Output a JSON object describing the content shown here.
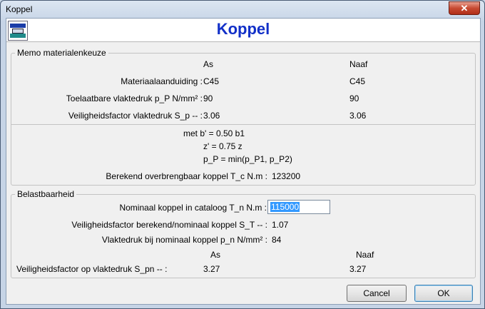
{
  "window": {
    "title": "Koppel",
    "close_glyph": "✕"
  },
  "header": {
    "title": "Koppel",
    "logo_icon": "koppel-logo-icon"
  },
  "memo": {
    "label": "Memo materialenkeuze",
    "col_as": "As",
    "col_naaf": "Naaf",
    "rows": [
      {
        "label": "Materiaalaanduiding :",
        "as": "C45",
        "naaf": "C45"
      },
      {
        "label": "Toelaatbare vlaktedruk   p_P   N/mm² :",
        "as": "90",
        "naaf": "90"
      },
      {
        "label": "Veiligheidsfactor vlaktedruk   S_p   -- :",
        "as": "3.06",
        "naaf": "3.06"
      }
    ],
    "formula": [
      "met b' = 0.50 b1",
      "z' = 0.75 z",
      "p_P = min(p_P1, p_P2)"
    ],
    "berekend_label": "Berekend overbrengbaar koppel   T_c   N.m :",
    "berekend_value": "123200"
  },
  "belast": {
    "label": "Belastbaarheid",
    "nominaal_label": "Nominaal koppel in cataloog   T_n   N.m :",
    "nominaal_value": "115000",
    "factor_label": "Veiligheidsfactor berekend/nominaal koppel   S_T   -- :",
    "factor_value": "1.07",
    "druk_label": "Vlaktedruk bij nominaal koppel   p_n   N/mm² :",
    "druk_value": "84",
    "col_as": "As",
    "col_naaf": "Naaf",
    "vlak_label": "Veiligheidsfactor op vlaktedruk   S_pn   -- :",
    "vlak_as": "3.27",
    "vlak_naaf": "3.27"
  },
  "buttons": {
    "cancel": "Cancel",
    "ok": "OK"
  }
}
